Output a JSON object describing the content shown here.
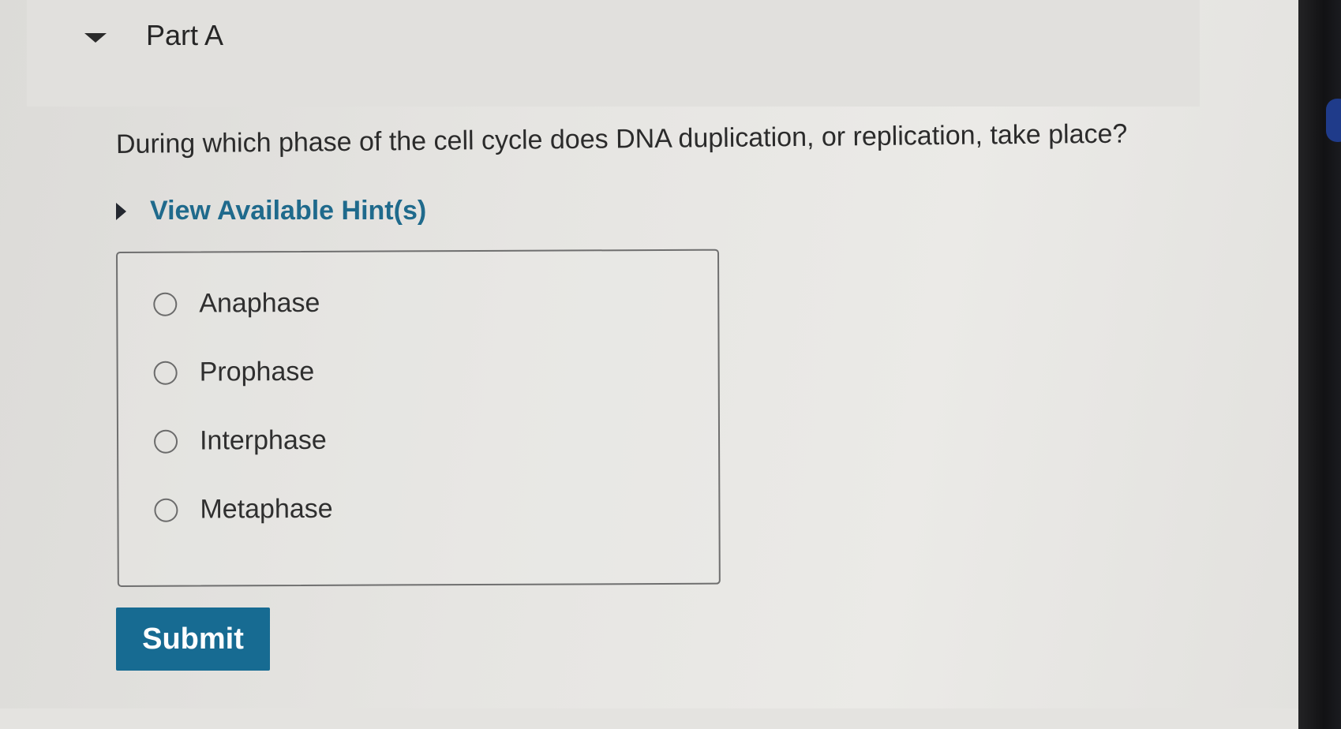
{
  "part": {
    "title": "Part A",
    "expanded": true
  },
  "question": {
    "text": "During which phase of the cell cycle does DNA duplication, or replication, take place?"
  },
  "hints": {
    "label": "View Available Hint(s)",
    "expanded": false
  },
  "choices": [
    {
      "label": "Anaphase",
      "selected": false
    },
    {
      "label": "Prophase",
      "selected": false
    },
    {
      "label": "Interphase",
      "selected": false
    },
    {
      "label": "Metaphase",
      "selected": false
    }
  ],
  "submit": {
    "label": "Submit"
  },
  "colors": {
    "accent": "#176b92",
    "hint_link": "#1f6a8c",
    "text": "#2b2b2b"
  }
}
